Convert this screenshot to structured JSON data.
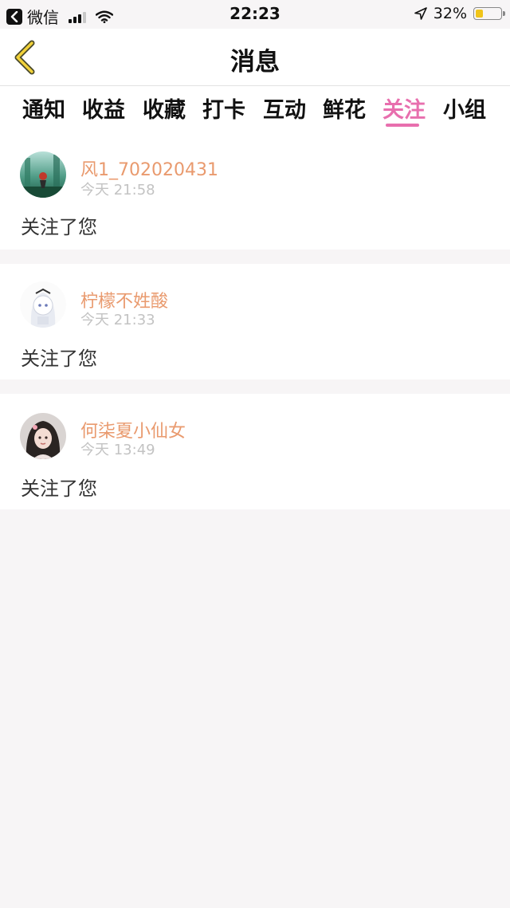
{
  "status_bar": {
    "app_name": "微信",
    "time": "22:23",
    "battery_percent": "32%",
    "battery_level": 0.32
  },
  "nav": {
    "title": "消息"
  },
  "tabs": [
    {
      "label": "通知"
    },
    {
      "label": "收益"
    },
    {
      "label": "收藏"
    },
    {
      "label": "打卡"
    },
    {
      "label": "互动"
    },
    {
      "label": "鲜花"
    },
    {
      "label": "关注"
    },
    {
      "label": "小组"
    }
  ],
  "active_tab": "关注",
  "messages": [
    {
      "username": "风1_702020431",
      "time": "今天 21:58",
      "text": "关注了您"
    },
    {
      "username": "柠檬不姓酸",
      "time": "今天 21:33",
      "text": "关注了您"
    },
    {
      "username": "何柒夏小仙女",
      "time": "今天 13:49",
      "text": "关注了您"
    }
  ],
  "colors": {
    "accent": "#e86fae",
    "username": "#e99a6e",
    "timestamp": "#c3c3c3",
    "background": "#f7f5f6"
  }
}
